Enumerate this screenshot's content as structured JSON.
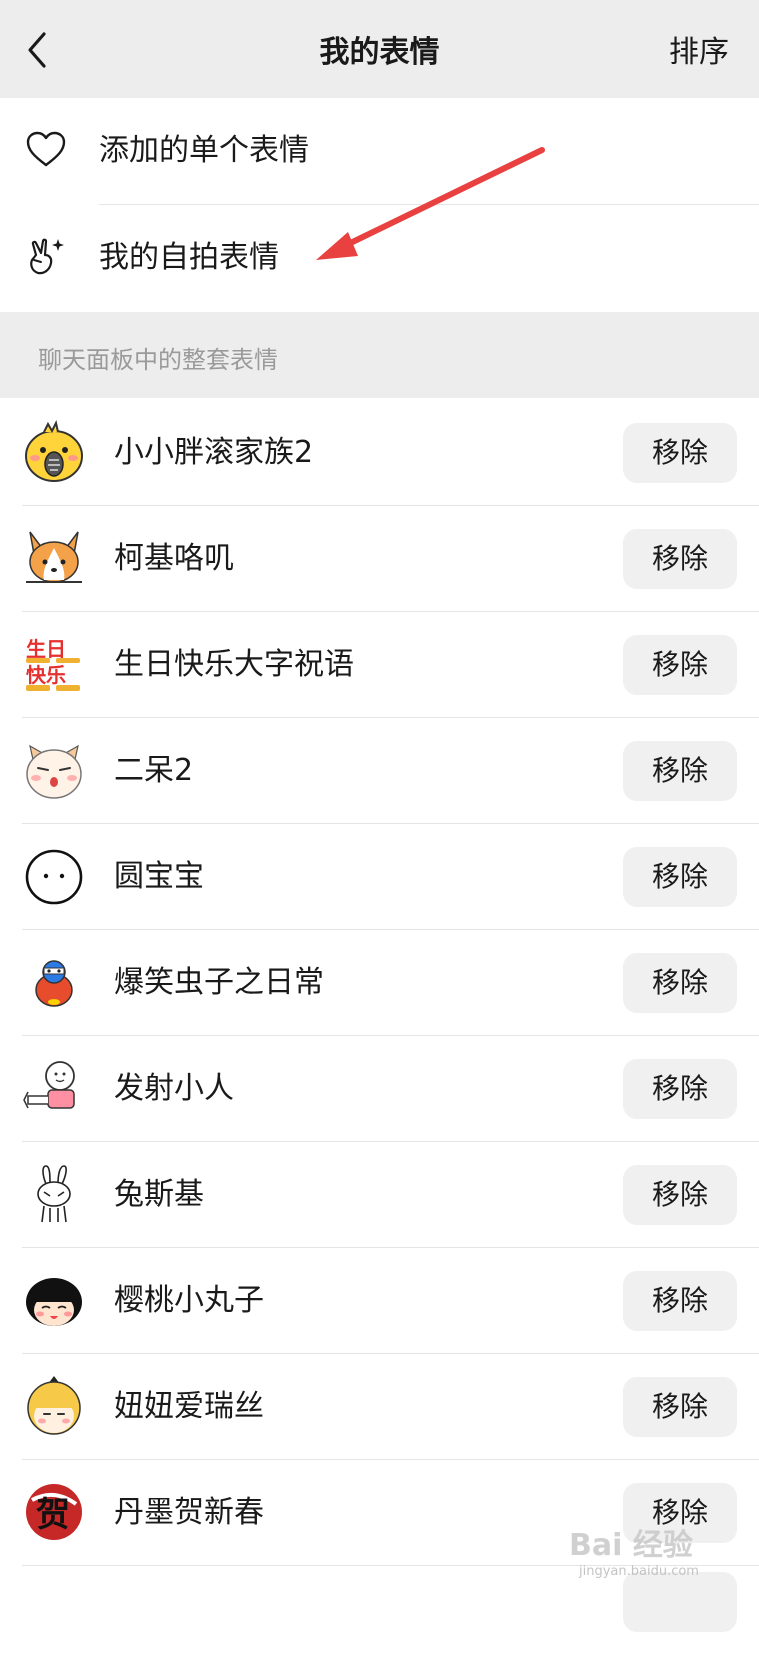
{
  "nav": {
    "title": "我的表情",
    "sort_label": "排序"
  },
  "top_items": [
    {
      "label": "添加的单个表情",
      "icon": "heart-icon"
    },
    {
      "label": "我的自拍表情",
      "icon": "peace-hand-sparkle-icon"
    }
  ],
  "section": {
    "label": "聊天面板中的整套表情"
  },
  "packs": [
    {
      "name": "小小胖滚家族2",
      "icon": "yellow-chick-eating-seed",
      "remove_label": "移除"
    },
    {
      "name": "柯基咯叽",
      "icon": "corgi-face",
      "remove_label": "移除"
    },
    {
      "name": "生日快乐大字祝语",
      "icon": "birthday-cake-text",
      "thumb_text": "生日快乐",
      "remove_label": "移除"
    },
    {
      "name": "二呆2",
      "icon": "shiba-dog-face",
      "remove_label": "移除"
    },
    {
      "name": "圆宝宝",
      "icon": "round-face-outline",
      "remove_label": "移除"
    },
    {
      "name": "爆笑虫子之日常",
      "icon": "red-bug-cartoon",
      "remove_label": "移除"
    },
    {
      "name": "发射小人",
      "icon": "pink-shooting-person",
      "remove_label": "移除"
    },
    {
      "name": "兔斯基",
      "icon": "tuzki-rabbit",
      "remove_label": "移除"
    },
    {
      "name": "樱桃小丸子",
      "icon": "maruko-face",
      "remove_label": "移除"
    },
    {
      "name": "妞妞爱瑞丝",
      "icon": "blonde-girl-face",
      "remove_label": "移除"
    },
    {
      "name": "丹墨贺新春",
      "icon": "ink-he-character",
      "thumb_text": "贺",
      "remove_label": "移除"
    }
  ],
  "watermark": {
    "text": "Bai 经验",
    "sub": "jingyan.baidu.com"
  },
  "colors": {
    "nav_bg": "#ededed",
    "arrow": "#e94040",
    "remove_bg": "#f0f0f0"
  }
}
